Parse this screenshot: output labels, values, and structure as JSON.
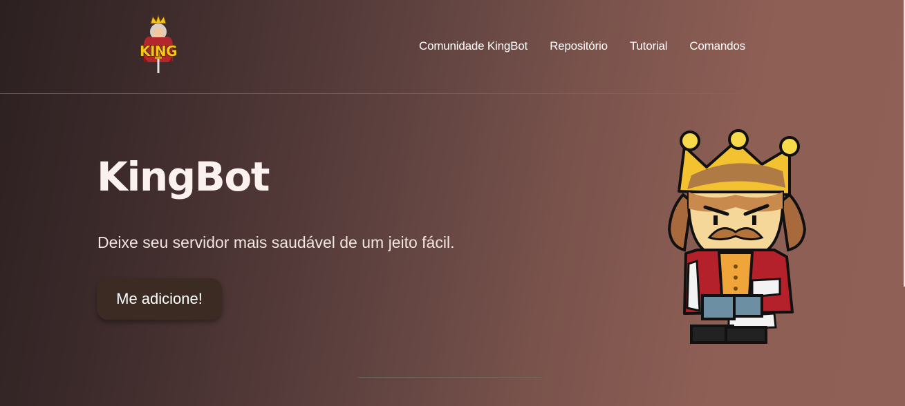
{
  "header": {
    "logo_text": "KING",
    "nav": [
      {
        "label": "Comunidade KingBot"
      },
      {
        "label": "Repositório"
      },
      {
        "label": "Tutorial"
      },
      {
        "label": "Comandos"
      }
    ]
  },
  "hero": {
    "title": "KingBot",
    "subtitle": "Deixe seu servidor mais saudável de um jeito fácil.",
    "cta_label": "Me adicione!"
  },
  "icons": {
    "logo": "king-logo-icon",
    "mascot": "king-mascot-illustration"
  },
  "colors": {
    "gradient_start": "#2c2021",
    "gradient_end": "#8f6055",
    "button_bg": "#3b2b23",
    "text": "#ffffff",
    "crown_gold": "#f5c518"
  }
}
